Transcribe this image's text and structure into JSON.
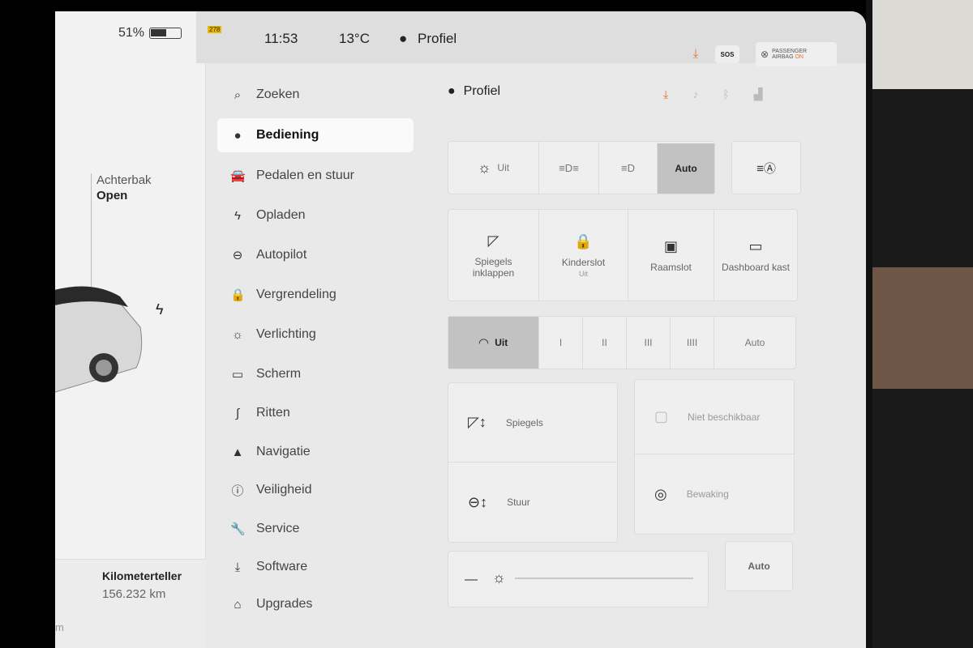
{
  "status": {
    "battery_percent": "51%",
    "badge": "278",
    "time": "11:53",
    "temperature": "13°C",
    "profile": "Profiel",
    "sos": "SOS",
    "airbag_line1": "PASSENGER",
    "airbag_line2": "AIRBAG",
    "airbag_state": "ON"
  },
  "car": {
    "trunk_label": "Achterbak",
    "trunk_value": "Open",
    "odometer_label": "Kilometerteller",
    "odometer_value": "156.232 km",
    "stub": "m"
  },
  "nav": {
    "search": "Zoeken",
    "items": [
      {
        "label": "Bediening",
        "icon": "toggle-icon",
        "glyph": "●",
        "active": true
      },
      {
        "label": "Pedalen en stuur",
        "icon": "car-icon",
        "glyph": "🚘"
      },
      {
        "label": "Opladen",
        "icon": "bolt-icon",
        "glyph": "ϟ"
      },
      {
        "label": "Autopilot",
        "icon": "steering-wheel-icon",
        "glyph": "⊖"
      },
      {
        "label": "Vergrendeling",
        "icon": "lock-icon",
        "glyph": "🔒"
      },
      {
        "label": "Verlichting",
        "icon": "sun-icon",
        "glyph": "☼"
      },
      {
        "label": "Scherm",
        "icon": "display-icon",
        "glyph": "▭"
      },
      {
        "label": "Ritten",
        "icon": "trips-icon",
        "glyph": "∫"
      },
      {
        "label": "Navigatie",
        "icon": "navigation-arrow-icon",
        "glyph": "▲"
      },
      {
        "label": "Veiligheid",
        "icon": "safety-icon",
        "glyph": "ⓘ"
      },
      {
        "label": "Service",
        "icon": "wrench-icon",
        "glyph": "🔧"
      },
      {
        "label": "Software",
        "icon": "download-icon",
        "glyph": "⤓"
      },
      {
        "label": "Upgrades",
        "icon": "bag-icon",
        "glyph": "⌂"
      }
    ]
  },
  "main": {
    "profile_title": "Profiel",
    "lights": {
      "off": "Uit",
      "auto": "Auto",
      "selected": "Auto"
    },
    "tiles": [
      {
        "label": "Spiegels",
        "label2": "inklappen",
        "sub": ""
      },
      {
        "label": "Kinderslot",
        "label2": "",
        "sub": "Uit"
      },
      {
        "label": "Raamslot",
        "label2": "",
        "sub": ""
      },
      {
        "label": "Dashboard kast",
        "label2": "",
        "sub": ""
      }
    ],
    "wipers": {
      "off": "Uit",
      "s1": "I",
      "s2": "II",
      "s3": "III",
      "s4": "IIII",
      "auto": "Auto",
      "selected": "Uit"
    },
    "adjust": {
      "mirrors": "Spiegels",
      "steering": "Stuur",
      "unavailable": "Niet beschikbaar",
      "monitor": "Bewaking"
    },
    "brightness": {
      "auto": "Auto"
    }
  },
  "colors": {
    "accent": "#e5712f",
    "selected": "#c2c2c2"
  }
}
